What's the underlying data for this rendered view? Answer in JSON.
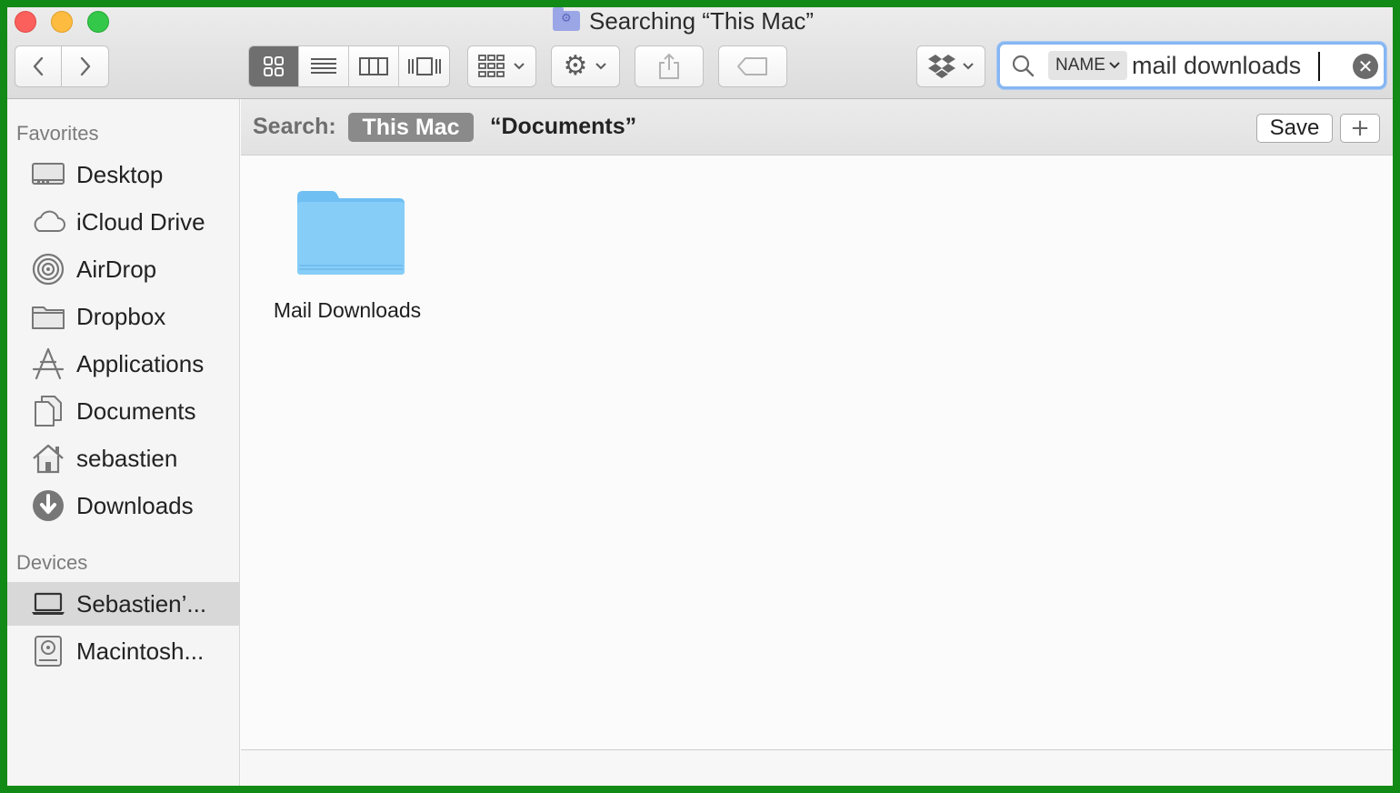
{
  "window": {
    "title": "Searching “This Mac”"
  },
  "toolbar": {
    "view_modes": [
      "icon-view",
      "list-view",
      "column-view",
      "coverflow-view"
    ],
    "active_view": "icon-view"
  },
  "search": {
    "scope_token": "NAME",
    "query": "mail downloads",
    "clear_icon": "✕"
  },
  "sidebar": {
    "favorites_header": "Favorites",
    "favorites": [
      {
        "label": "Desktop",
        "icon": "desktop-icon"
      },
      {
        "label": "iCloud Drive",
        "icon": "cloud-icon"
      },
      {
        "label": "AirDrop",
        "icon": "airdrop-icon"
      },
      {
        "label": "Dropbox",
        "icon": "folder-icon"
      },
      {
        "label": "Applications",
        "icon": "applications-icon"
      },
      {
        "label": "Documents",
        "icon": "documents-icon"
      },
      {
        "label": "sebastien",
        "icon": "home-icon"
      },
      {
        "label": "Downloads",
        "icon": "downloads-icon"
      }
    ],
    "devices_header": "Devices",
    "devices": [
      {
        "label": "Sebastien’...",
        "icon": "laptop-icon",
        "selected": true
      },
      {
        "label": "Macintosh...",
        "icon": "hard-drive-icon",
        "selected": false
      }
    ]
  },
  "scopebar": {
    "label": "Search:",
    "active_scope": "This Mac",
    "other_scope": "“Documents”",
    "save_label": "Save",
    "add_label": "+"
  },
  "results": [
    {
      "name": "Mail Downloads",
      "kind": "folder"
    }
  ],
  "colors": {
    "frame_green": "#128a16",
    "folder_blue": "#7ec8f6",
    "search_focus": "#86b6f2"
  }
}
